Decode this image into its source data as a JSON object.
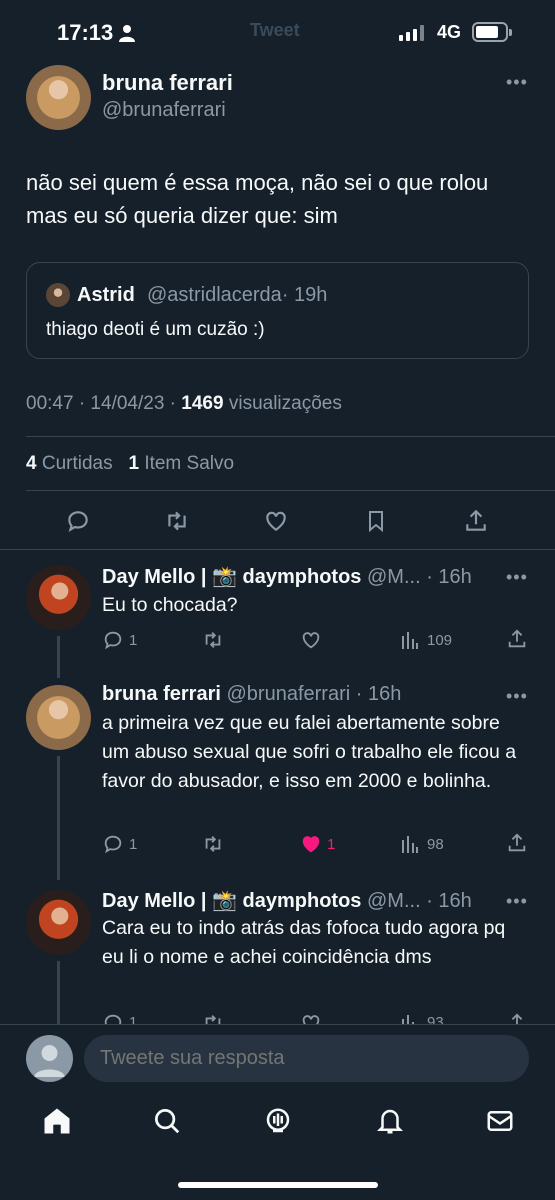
{
  "status_bar": {
    "time": "17:13",
    "network": "4G",
    "background_title": "Tweet"
  },
  "main_tweet": {
    "author_name": "bruna ferrari",
    "author_handle": "@brunaferrari",
    "text": "não sei quem é essa moça, não sei o que rolou mas eu só queria dizer que: sim",
    "quote": {
      "author_name": "Astrid",
      "author_handle": "@astridlacerda",
      "time": "· 19h",
      "text": "thiago deoti é um cuzão :)"
    },
    "timestamp": "00:47 · 14/04/23 ·",
    "views_count": "1469",
    "views_label": "visualizações",
    "retweets_count": "4",
    "retweets_label": "Curtidas",
    "saved_count": "1",
    "saved_label": "Item Salvo"
  },
  "replies": [
    {
      "author_name": "Day Mello | 📸 daymphotos",
      "handle_time": "@M... · 16h",
      "text": "Eu to chocada?",
      "replies": "1",
      "likes": "",
      "views": "109"
    },
    {
      "author_name": "bruna ferrari",
      "handle_time": "@brunaferrari · 16h",
      "text": "a primeira vez que eu falei abertamente sobre um abuso sexual que sofri o trabalho ele ficou a favor do abusador, e isso em 2000 e bolinha.",
      "replies": "1",
      "likes": "1",
      "views": "98"
    },
    {
      "author_name": "Day Mello | 📸 daymphotos",
      "handle_time": "@M... · 16h",
      "text": "Cara eu to indo atrás das fofoca tudo agora pq eu li o nome e achei coincidência dms",
      "replies": "1",
      "likes": "",
      "views": "93"
    }
  ],
  "composer": {
    "placeholder": "Tweete sua resposta"
  },
  "colors": {
    "background": "#15202b",
    "text": "#f7f9f9",
    "muted": "#8b98a5",
    "like_active": "#f91880",
    "border": "#38444d"
  },
  "tab_bar": {
    "icons": [
      "home-icon",
      "search-icon",
      "spaces-icon",
      "notifications-icon",
      "messages-icon"
    ]
  }
}
